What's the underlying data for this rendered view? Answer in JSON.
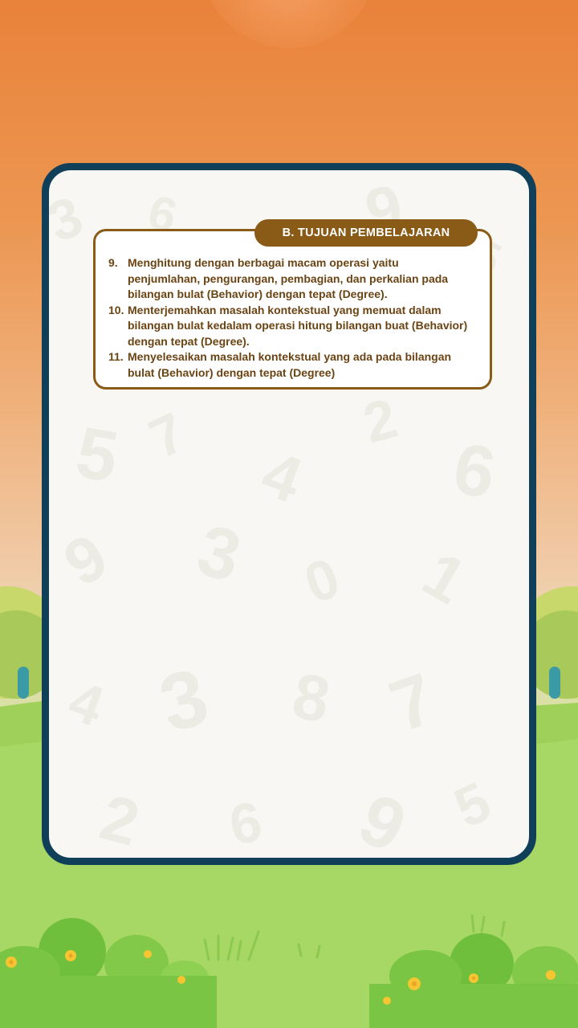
{
  "section": {
    "title": "B. TUJUAN PEMBELAJARAN",
    "objectives": [
      {
        "number": "9.",
        "text": "Menghitung dengan berbagai macam operasi yaitu penjumlahan, pengurangan, pembagian, dan perkalian pada bilangan bulat (Behavior) dengan tepat (Degree)."
      },
      {
        "number": "10.",
        "text": "Menterjemahkan masalah kontekstual yang memuat dalam bilangan bulat kedalam operasi hitung bilangan buat (Behavior) dengan tepat (Degree)."
      },
      {
        "number": "11.",
        "text": "Menyelesaikan masalah kontekstual yang ada pada bilangan bulat (Behavior) dengan tepat (Degree)"
      }
    ]
  },
  "colors": {
    "card_border": "#103f5a",
    "accent_brown": "#8a5a17",
    "text_brown": "#6b4414",
    "sky_orange": "#e9823a",
    "grass_green": "#a8d45d"
  },
  "decor": {
    "background": "number-pattern",
    "scenery": [
      "bush-icon",
      "flower-icon",
      "grass-icon"
    ]
  }
}
